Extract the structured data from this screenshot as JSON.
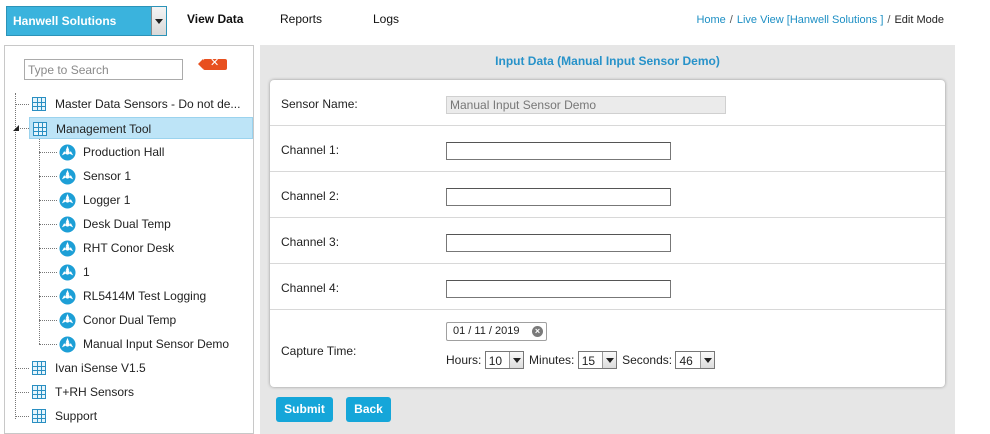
{
  "header": {
    "company": "Hanwell Solutions",
    "nav": [
      "View Data",
      "Reports",
      "Logs"
    ],
    "active_nav": "View Data",
    "breadcrumb": {
      "home": "Home",
      "live_view": "Live View [Hanwell Solutions ]",
      "current": "Edit Mode",
      "separator": "/"
    }
  },
  "sidebar": {
    "search_placeholder": "Type to Search",
    "clear_label": "✕",
    "tree": [
      {
        "label": "Master Data Sensors - Do not de...",
        "type": "group",
        "level": 0
      },
      {
        "label": "Management Tool",
        "type": "group",
        "level": 0,
        "expanded": true,
        "selected": true
      },
      {
        "label": "Production Hall",
        "type": "sensor",
        "level": 1
      },
      {
        "label": "Sensor 1",
        "type": "sensor",
        "level": 1
      },
      {
        "label": "Logger 1",
        "type": "sensor",
        "level": 1
      },
      {
        "label": "Desk Dual Temp",
        "type": "sensor",
        "level": 1
      },
      {
        "label": "RHT Conor Desk",
        "type": "sensor",
        "level": 1
      },
      {
        "label": "1",
        "type": "sensor",
        "level": 1
      },
      {
        "label": "RL5414M Test Logging",
        "type": "sensor",
        "level": 1
      },
      {
        "label": "Conor Dual Temp",
        "type": "sensor",
        "level": 1
      },
      {
        "label": "Manual Input Sensor Demo",
        "type": "sensor",
        "level": 1
      },
      {
        "label": "Ivan iSense V1.5",
        "type": "group",
        "level": 0
      },
      {
        "label": "T+RH Sensors",
        "type": "group",
        "level": 0
      },
      {
        "label": "Support",
        "type": "group",
        "level": 0
      }
    ]
  },
  "form": {
    "title": "Input Data (Manual Input Sensor Demo)",
    "sensor_name_label": "Sensor Name:",
    "sensor_name_value": "Manual Input Sensor Demo",
    "channels": [
      {
        "label": "Channel 1:",
        "value": ""
      },
      {
        "label": "Channel 2:",
        "value": ""
      },
      {
        "label": "Channel 3:",
        "value": ""
      },
      {
        "label": "Channel 4:",
        "value": ""
      }
    ],
    "capture_time_label": "Capture Time:",
    "date_value": "01 / 11 / 2019",
    "hours_label": "Hours:",
    "hours_value": "10",
    "minutes_label": "Minutes:",
    "minutes_value": "15",
    "seconds_label": "Seconds:",
    "seconds_value": "46",
    "submit_label": "Submit",
    "back_label": "Back"
  },
  "colors": {
    "accent": "#15a6d9",
    "title_blue": "#2792c9",
    "selected_row": "#bde4f7",
    "clear_button": "#e8501f"
  }
}
